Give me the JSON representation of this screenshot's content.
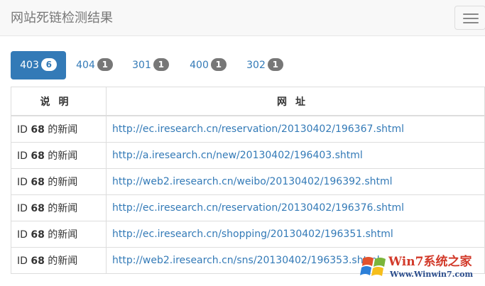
{
  "header": {
    "title": "网站死链检测结果"
  },
  "tabs": [
    {
      "label": "403",
      "count": "6"
    },
    {
      "label": "404",
      "count": "1"
    },
    {
      "label": "301",
      "count": "1"
    },
    {
      "label": "400",
      "count": "1"
    },
    {
      "label": "302",
      "count": "1"
    }
  ],
  "table": {
    "headers": {
      "desc": "说明",
      "url": "网址"
    },
    "rows": [
      {
        "id_prefix": "ID ",
        "id": "68",
        "suffix": " 的新闻",
        "url": "http://ec.iresearch.cn/reservation/20130402/196367.shtml"
      },
      {
        "id_prefix": "ID ",
        "id": "68",
        "suffix": " 的新闻",
        "url": "http://a.iresearch.cn/new/20130402/196403.shtml"
      },
      {
        "id_prefix": "ID ",
        "id": "68",
        "suffix": " 的新闻",
        "url": "http://web2.iresearch.cn/weibo/20130402/196392.shtml"
      },
      {
        "id_prefix": "ID ",
        "id": "68",
        "suffix": " 的新闻",
        "url": "http://ec.iresearch.cn/reservation/20130402/196376.shtml"
      },
      {
        "id_prefix": "ID ",
        "id": "68",
        "suffix": " 的新闻",
        "url": "http://ec.iresearch.cn/shopping/20130402/196351.shtml"
      },
      {
        "id_prefix": "ID ",
        "id": "68",
        "suffix": " 的新闻",
        "url": "http://web2.iresearch.cn/sns/20130402/196353.shtml"
      }
    ]
  },
  "watermark": {
    "text": "Win7系统之家",
    "url": "Www.Winwin7.com"
  },
  "colors": {
    "accent": "#337ab7",
    "badge": "#777777"
  }
}
